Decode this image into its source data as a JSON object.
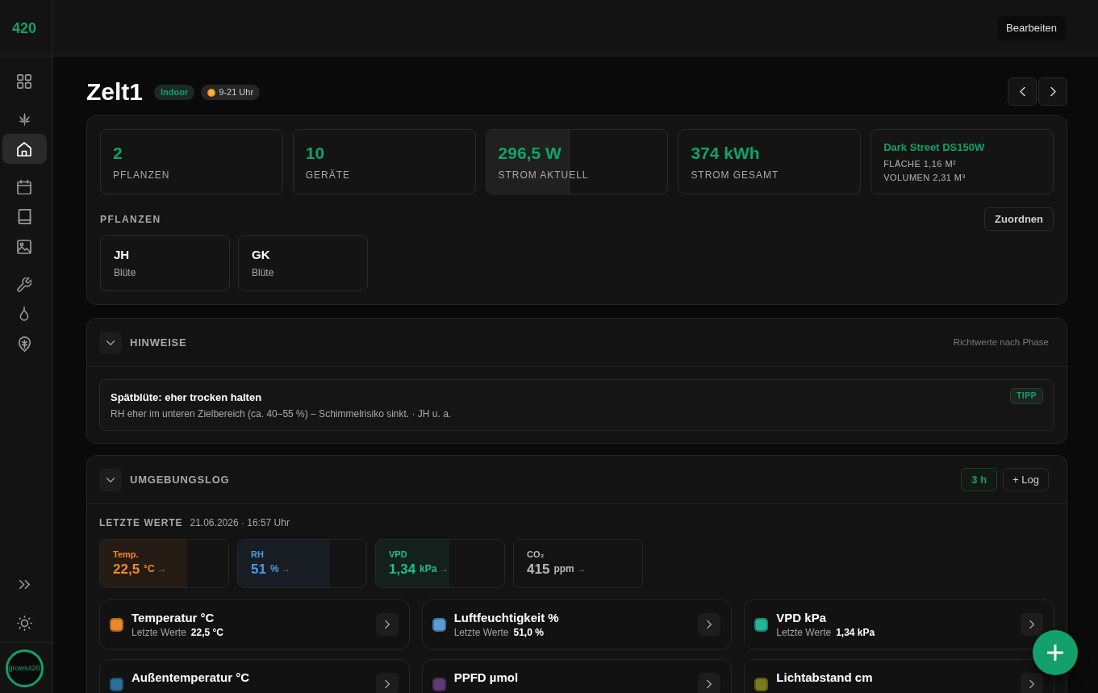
{
  "sidebar": {
    "logo": "420",
    "items": [
      {
        "selected": false
      },
      {
        "selected": false
      },
      {
        "selected": true
      },
      {
        "selected": false
      },
      {
        "selected": false
      },
      {
        "selected": false
      },
      {
        "selected": false
      },
      {
        "selected": false
      },
      {
        "selected": false
      }
    ],
    "account": "grows420"
  },
  "topbar": {
    "edit_button": "Bearbeiten"
  },
  "header": {
    "title": "Zelt1",
    "badges": [
      {
        "kind": "location",
        "label": "Indoor"
      },
      {
        "kind": "schedule",
        "label": "9-21 Uhr"
      }
    ]
  },
  "overview": {
    "stats": [
      {
        "kind": "stat",
        "value": "2",
        "label": "PFLANZEN"
      },
      {
        "kind": "stat",
        "value": "10",
        "label": "GERÄTE"
      },
      {
        "kind": "stat",
        "value": "296,5 W",
        "label": "STROM AKTUELL",
        "level": 0.46
      },
      {
        "kind": "stat",
        "value": "374 kWh",
        "label": "STROM GESAMT"
      },
      {
        "kind": "lamp",
        "title": "Dark Street DS150W",
        "lines": [
          "FLÄCHE 1,16 M²",
          "VOLUMEN 2,31 M³"
        ]
      }
    ],
    "plants_heading": "PFLANZEN",
    "assign_button": "Zuordnen",
    "plants": [
      {
        "name": "JH",
        "phase": "Blüte"
      },
      {
        "name": "GK",
        "phase": "Blüte"
      }
    ]
  },
  "hints": {
    "title": "HINWEISE",
    "expanded": true,
    "note": "Richtwerte nach Phase",
    "items": [
      {
        "title": "Spätblüte: eher trocken halten",
        "tag": "TIPP",
        "text": "RH eher im unteren Zielbereich (ca. 40–55 %) – Schimmelrisiko sinkt. · JH u. a."
      }
    ]
  },
  "environment_log": {
    "title": "UMGEBUNGSLOG",
    "expanded": true,
    "range_button": "3 h",
    "log_button": "+ Log",
    "latest_label": "LETZTE WERTE",
    "latest_time": "21.06.2026 · 16:57 Uhr",
    "readings": [
      {
        "label": "Temp.",
        "value": "22,5",
        "unit": "°C",
        "trend": "→",
        "level": 0.68,
        "color": "#f08a24"
      },
      {
        "label": "RH",
        "value": "51",
        "unit": "%",
        "trend": "→",
        "level": 0.72,
        "color": "#4f9be0"
      },
      {
        "label": "VPD",
        "value": "1,34",
        "unit": "kPa",
        "trend": "→",
        "level": 0.57,
        "color": "#1fbf8a"
      },
      {
        "label": "CO₂",
        "value": "415",
        "unit": "ppm",
        "trend": "→",
        "color": "#b8b8b8"
      }
    ],
    "sensors": [
      {
        "title": "Temperatur °C",
        "value_label": "Letzte Werte",
        "value": "22,5 °C",
        "color": "#e8892a"
      },
      {
        "title": "Luftfeuchtigkeit %",
        "value_label": "Letzte Werte",
        "value": "51,0 %",
        "color": "#5b9bd5"
      },
      {
        "title": "VPD kPa",
        "value_label": "Letzte Werte",
        "value": "1,34 kPa",
        "color": "#26b39a"
      },
      {
        "title": "Außentemperatur °C",
        "color": "#2b6f9a"
      },
      {
        "title": "PPFD µmol",
        "color": "#5b3d73"
      },
      {
        "title": "Lichtabstand cm",
        "color": "#7d7a1e"
      }
    ]
  }
}
